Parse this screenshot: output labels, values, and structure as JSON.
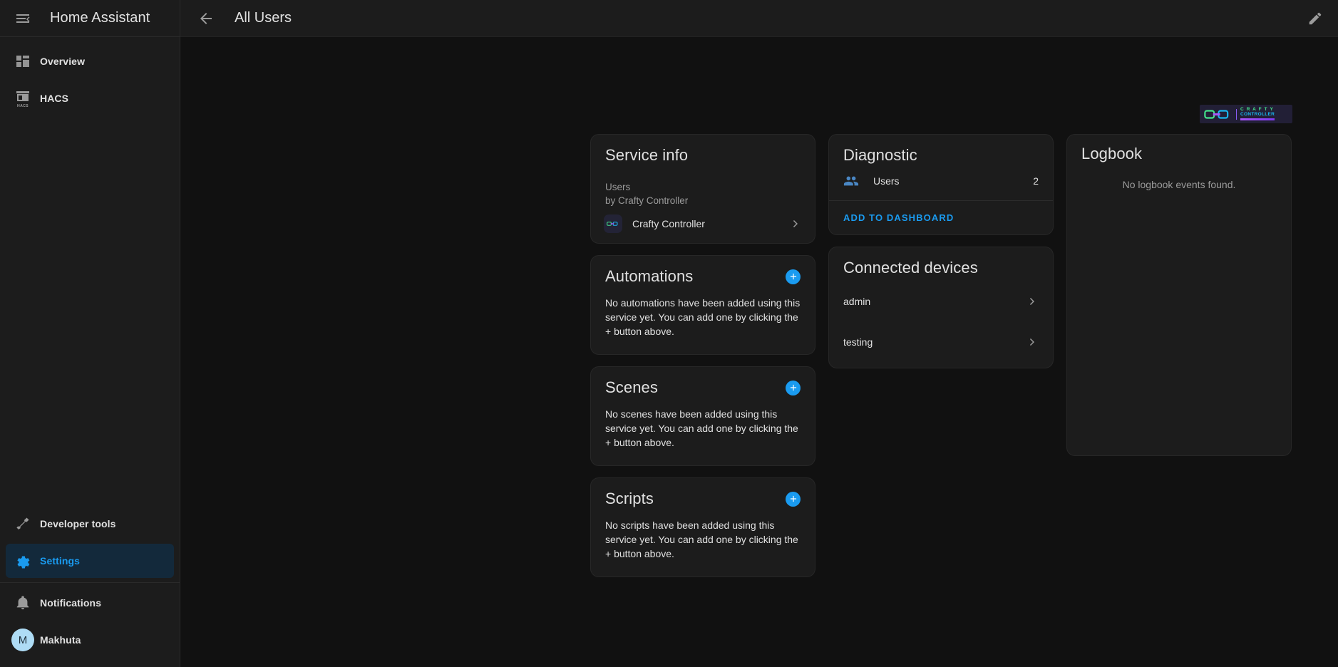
{
  "sidebar": {
    "app_title": "Home Assistant",
    "menu_icon": "menu-collapse-icon",
    "items": [
      {
        "label": "Overview",
        "icon": "view-dashboard-icon",
        "active": false
      },
      {
        "label": "HACS",
        "icon": "hacs-store-icon",
        "badge_text": "HACS",
        "active": false
      }
    ],
    "bottom_items": [
      {
        "label": "Developer tools",
        "icon": "hammer-icon",
        "active": false
      },
      {
        "label": "Settings",
        "icon": "gear-icon",
        "active": true
      }
    ],
    "footer_items": [
      {
        "label": "Notifications",
        "icon": "bell-icon"
      }
    ],
    "user": {
      "name": "Makhuta",
      "initial": "M"
    }
  },
  "toolbar": {
    "back_icon": "arrow-left-icon",
    "title": "All Users",
    "edit_icon": "pencil-icon"
  },
  "brand": {
    "name": "CRAFTY CONTROLLER",
    "word_top": "C R A F T Y",
    "word_bottom": "CONTROLLER"
  },
  "cards": {
    "service_info": {
      "title": "Service info",
      "line1": "Users",
      "line2": "by Crafty Controller",
      "link_label": "Crafty Controller",
      "link_icon": "crafty-controller-icon",
      "chevron_icon": "chevron-right-icon"
    },
    "diagnostic": {
      "title": "Diagnostic",
      "rows": [
        {
          "icon": "account-group-icon",
          "label": "Users",
          "value": "2"
        }
      ],
      "action_label": "ADD TO DASHBOARD"
    },
    "automations": {
      "title": "Automations",
      "add_icon": "plus-circle-icon",
      "body": "No automations have been added using this service yet. You can add one by clicking the + button above."
    },
    "scenes": {
      "title": "Scenes",
      "add_icon": "plus-circle-icon",
      "body": "No scenes have been added using this service yet. You can add one by clicking the + button above."
    },
    "scripts": {
      "title": "Scripts",
      "add_icon": "plus-circle-icon",
      "body": "No scripts have been added using this service yet. You can add one by clicking the + button above."
    },
    "connected_devices": {
      "title": "Connected devices",
      "devices": [
        {
          "label": "admin",
          "chevron_icon": "chevron-right-icon"
        },
        {
          "label": "testing",
          "chevron_icon": "chevron-right-icon"
        }
      ]
    },
    "logbook": {
      "title": "Logbook",
      "empty_text": "No logbook events found."
    }
  },
  "colors": {
    "accent": "#1a9bf0",
    "background": "#111111",
    "card": "#1c1c1c",
    "text_primary": "#e1e1e1",
    "text_secondary": "#9b9b9b",
    "active_sidebar_bg": "#13293b",
    "avatar_bg": "#aedcf5"
  }
}
